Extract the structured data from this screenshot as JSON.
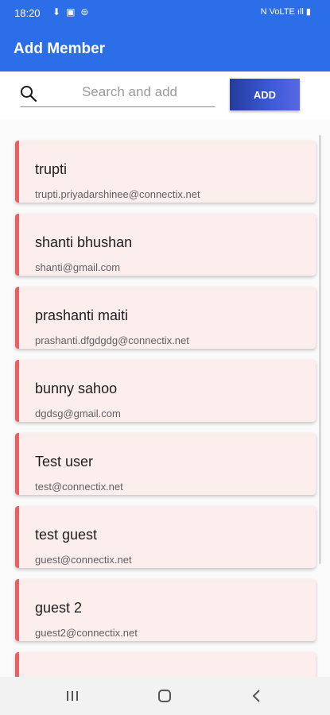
{
  "status_bar": {
    "time": "18:20",
    "left_icons": [
      "download-icon",
      "image-icon",
      "cast-icon"
    ],
    "right_icons": [
      "mute-icon",
      "volte-icon",
      "signal-icon",
      "battery-icon"
    ],
    "right_text": "N VoLTE ıll ▮"
  },
  "app_bar": {
    "title": "Add Member",
    "background": "#2c6de8"
  },
  "search": {
    "placeholder": "Search and add",
    "value": ""
  },
  "add_button": {
    "label": "ADD"
  },
  "members": [
    {
      "name": "trupti",
      "email": "trupti.priyadarshinee@connectix.net"
    },
    {
      "name": "shanti bhushan",
      "email": "shanti@gmail.com"
    },
    {
      "name": "prashanti maiti",
      "email": "prashanti.dfgdgdg@connectix.net"
    },
    {
      "name": "bunny sahoo",
      "email": "dgdsg@gmail.com"
    },
    {
      "name": "Test user",
      "email": "test@connectix.net"
    },
    {
      "name": "test guest",
      "email": "guest@connectix.net"
    },
    {
      "name": "guest 2",
      "email": "guest2@connectix.net"
    },
    {
      "name": "",
      "email": ""
    }
  ],
  "colors": {
    "accent": "#2c6de8",
    "card_background": "#fdeeee",
    "card_stripe": "#ef5e5e",
    "add_button": "#3d5ad8"
  },
  "nav_bar": {
    "buttons": [
      "recent-apps-icon",
      "home-icon",
      "back-icon"
    ]
  }
}
